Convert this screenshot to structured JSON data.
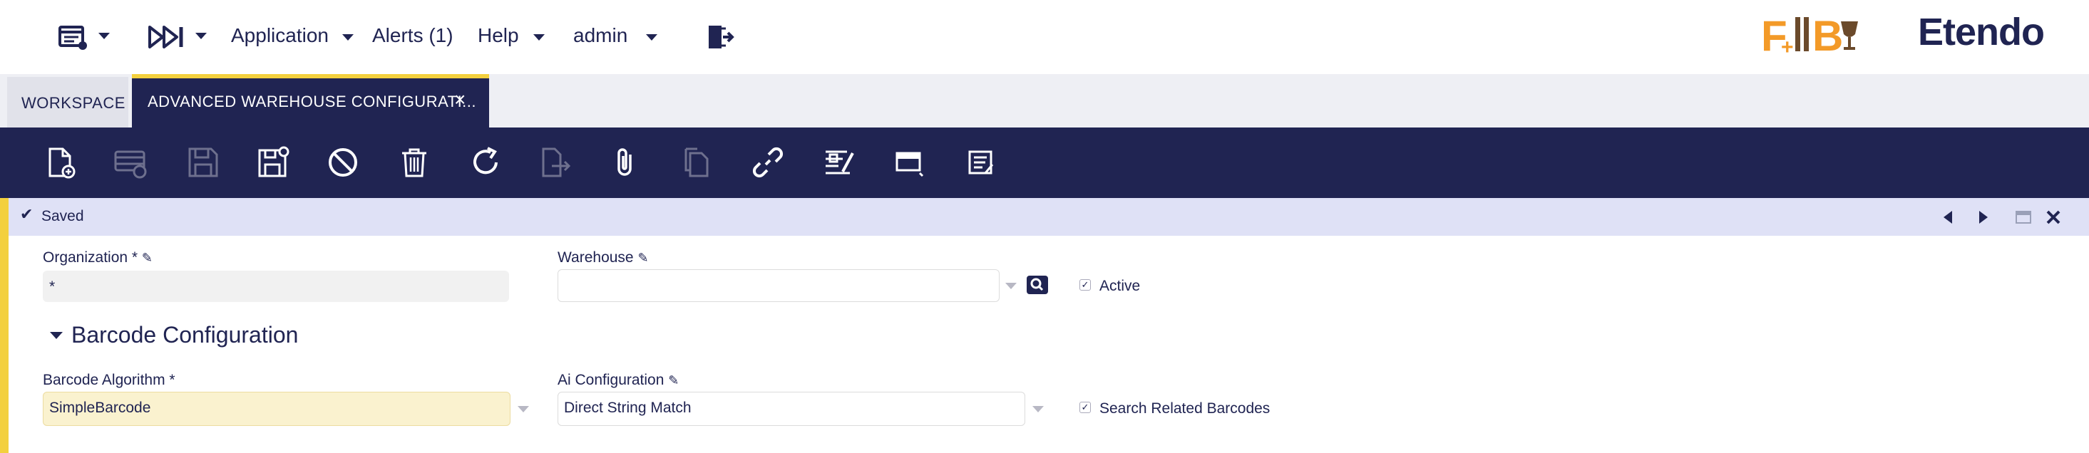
{
  "nav": {
    "application": "Application",
    "alerts": "Alerts (1)",
    "help": "Help",
    "user": "admin",
    "logo_text": "Etendo"
  },
  "tabs": [
    {
      "label": "WORKSPACE"
    },
    {
      "label": "ADVANCED WAREHOUSE CONFIGURATI...",
      "close": "×"
    }
  ],
  "status": {
    "text": "Saved"
  },
  "form": {
    "organization": {
      "label": "Organization *",
      "value": "*"
    },
    "warehouse": {
      "label": "Warehouse",
      "value": ""
    },
    "active": {
      "label": "Active",
      "checked": true
    },
    "section_title": "Barcode Configuration",
    "barcode_algorithm": {
      "label": "Barcode Algorithm *",
      "value": "SimpleBarcode"
    },
    "ai_configuration": {
      "label": "Ai Configuration",
      "value": "Direct String Match"
    },
    "search_related": {
      "label": "Search Related Barcodes",
      "checked": true
    }
  },
  "colors": {
    "navy": "#202452",
    "accent_yellow": "#f3d03e",
    "logo_orange": "#f39a28",
    "logo_brown": "#6b4a2b"
  }
}
